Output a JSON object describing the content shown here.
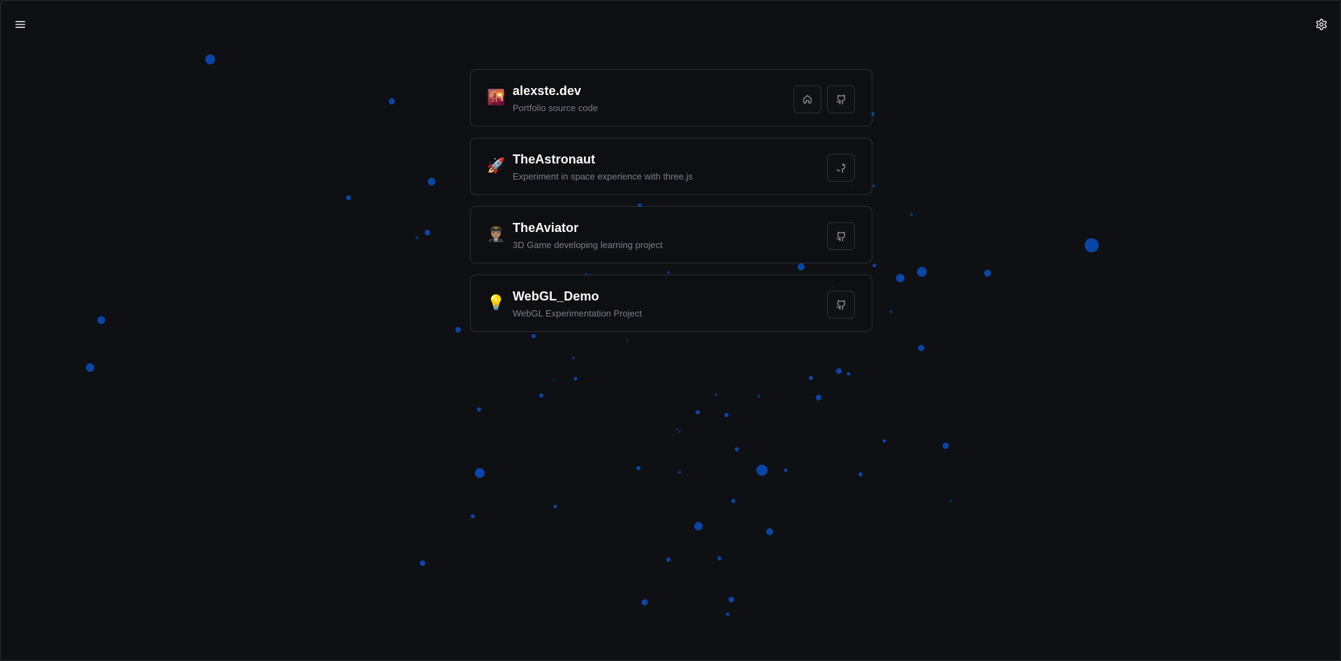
{
  "toolbar": {
    "menu_icon": "hamburger-menu-icon",
    "settings_icon": "gear-icon"
  },
  "colors": {
    "background": "#0e1013",
    "card_border": "#2c2e33",
    "particle": "#0a46a8",
    "title": "#fafafa",
    "description": "#7b7f87"
  },
  "projects": [
    {
      "emoji": "🌇",
      "icon": "cityscape-icon",
      "title": "alexste.dev",
      "description": "Portfolio source code",
      "actions": [
        "home-icon",
        "github-icon"
      ]
    },
    {
      "emoji": "🚀",
      "icon": "rocket-icon",
      "title": "TheAstronaut",
      "description": "Experiment in space experience with three.js",
      "actions": [
        "github-icon"
      ]
    },
    {
      "emoji": "👨🏽‍✈️",
      "icon": "pilot-icon",
      "title": "TheAviator",
      "description": "3D Game developing learning project",
      "actions": [
        "github-icon"
      ]
    },
    {
      "emoji": "💡",
      "icon": "lightbulb-icon",
      "title": "WebGL_Demo",
      "description": "WebGL Experimentation Project",
      "actions": [
        "github-icon"
      ]
    }
  ]
}
